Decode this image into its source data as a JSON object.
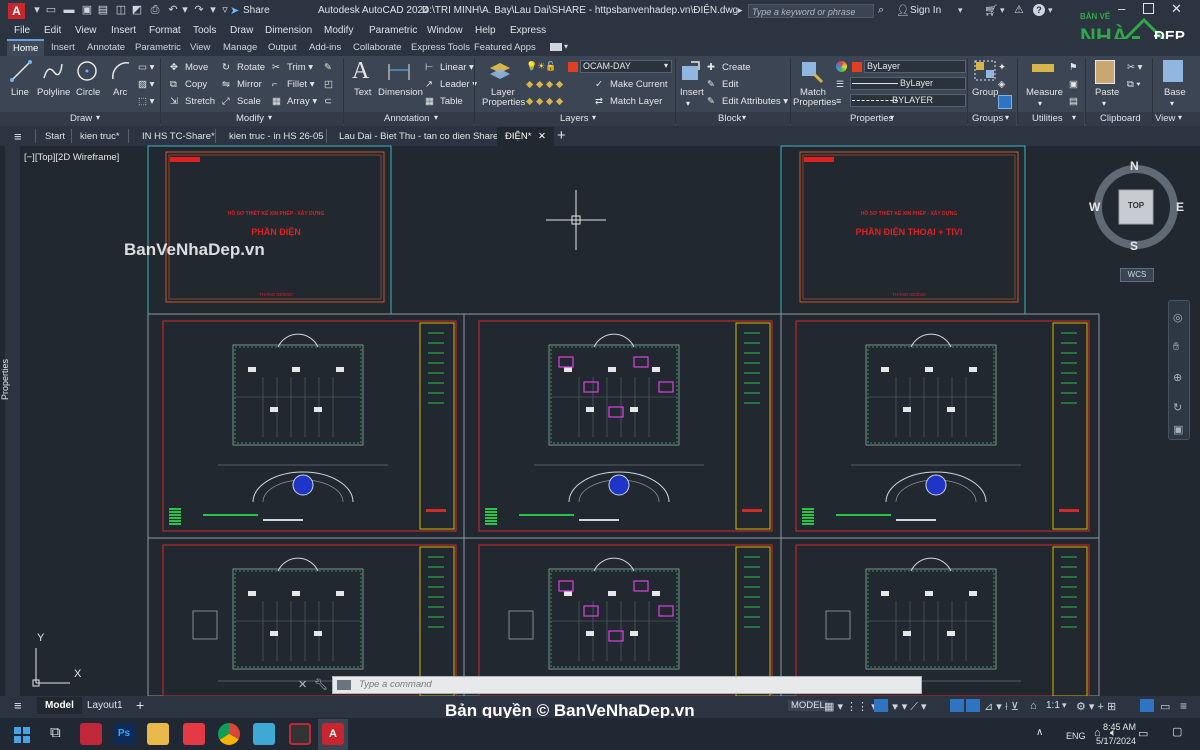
{
  "titlebar": {
    "app_icon": "A",
    "share": "Share",
    "title": "Autodesk AutoCAD 2024",
    "path": "D:\\TRI MINH\\A. Bay\\Lau Dai\\SHARE - httpsbanvenhadep.vn\\ĐIỆN.dwg",
    "search_placeholder": "Type a keyword or phrase",
    "sign_in": "Sign In"
  },
  "menu": [
    "File",
    "Edit",
    "View",
    "Insert",
    "Format",
    "Tools",
    "Draw",
    "Dimension",
    "Modify",
    "Parametric",
    "Window",
    "Help",
    "Express"
  ],
  "ribbon_tabs": [
    "Home",
    "Insert",
    "Annotate",
    "Parametric",
    "View",
    "Manage",
    "Output",
    "Add-ins",
    "Collaborate",
    "Express Tools",
    "Featured Apps"
  ],
  "draw": {
    "line": "Line",
    "polyline": "Polyline",
    "circle": "Circle",
    "arc": "Arc",
    "panel": "Draw"
  },
  "modify": {
    "move": "Move",
    "rotate": "Rotate",
    "trim": "Trim",
    "copy": "Copy",
    "mirror": "Mirror",
    "fillet": "Fillet",
    "stretch": "Stretch",
    "scale": "Scale",
    "array": "Array",
    "panel": "Modify"
  },
  "annotation": {
    "text": "Text",
    "dimension": "Dimension",
    "linear": "Linear",
    "leader": "Leader",
    "table": "Table",
    "panel": "Annotation"
  },
  "layers": {
    "layer_properties_1": "Layer",
    "layer_properties_2": "Properties",
    "current_layer": "OCAM-DAY",
    "make_current": "Make Current",
    "match_layer": "Match Layer",
    "panel": "Layers"
  },
  "block": {
    "insert": "Insert",
    "create": "Create",
    "edit": "Edit",
    "edit_attributes": "Edit Attributes",
    "panel": "Block"
  },
  "properties": {
    "match_1": "Match",
    "match_2": "Properties",
    "color": "ByLayer",
    "linetype": "ByLayer",
    "lineweight": "BYLAYER",
    "panel": "Properties"
  },
  "groups": {
    "group": "Group",
    "panel": "Groups"
  },
  "utilities": {
    "measure": "Measure",
    "panel": "Utilities"
  },
  "clipboard": {
    "paste": "Paste",
    "panel": "Clipboard"
  },
  "view": {
    "base": "Base",
    "panel": "View"
  },
  "file_tabs": [
    "Start",
    "kien truc*",
    "IN HS TC-Share*",
    "kien truc - in HS 26-05",
    "Lau Dai - Biet Thu - tan co dien Share*",
    "ĐIỆN*"
  ],
  "viewport": {
    "label": "[−][Top][2D Wireframe]",
    "properties_label": "Properties"
  },
  "viewcube": {
    "n": "N",
    "s": "S",
    "e": "E",
    "w": "W",
    "top": "TOP",
    "wcs": "WCS"
  },
  "sheets": {
    "cover1_heading": "HỒ SƠ THIẾT KẾ XIN PHÉP - XÂY DỰNG",
    "cover1_title": "PHẦN ĐIỆN",
    "cover1_date": "THÁNG 03/2020",
    "cover2_heading": "HỒ SƠ THIẾT KẾ XIN PHÉP - XÂY DỰNG",
    "cover2_title": "PHẦN ĐIỆN THOẠI + TIVI",
    "cover2_date": "THÁNG 03/2020"
  },
  "watermark": "BanVeNhaDep.vn",
  "logo": {
    "top": "BẢN VẼ",
    "mid": "NHÀ",
    "right": "ĐẸP"
  },
  "copyright": "Bản quyền © BanVeNhaDep.vn",
  "command": {
    "placeholder": "Type a command"
  },
  "status": {
    "model_tab": "Model",
    "layout_tab": "Layout1",
    "plus": "+",
    "model_btn": "MODEL",
    "scale": "1:1"
  },
  "axes": {
    "x": "X",
    "y": "Y"
  },
  "taskbar": {
    "lang": "ENG",
    "time": "8:45 AM",
    "date": "5/17/2024"
  },
  "colors": {
    "titlebar": "#2b3440",
    "ribbon": "#3b4553",
    "canvas": "#212830",
    "sheet_border": "#8f9aa6",
    "red": "#d22a2a",
    "yellow": "#d6b600",
    "green": "#27c44a",
    "magenta": "#e040e0",
    "blue": "#1f35c8",
    "cyan_frame": "#3cb6c0"
  }
}
